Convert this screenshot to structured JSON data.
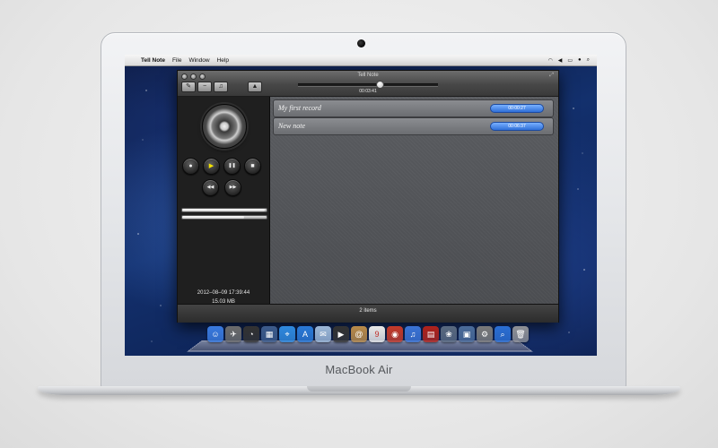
{
  "laptop": {
    "brand": "MacBook Air"
  },
  "menubar": {
    "apple": "",
    "items": [
      "Tell Note",
      "File",
      "Window",
      "Help"
    ]
  },
  "window": {
    "title": "Tell Note",
    "toolbar": {
      "btn_edit": "✎",
      "btn_remove": "−",
      "btn_music": "♫",
      "btn_eject": "▲"
    },
    "playback_time": "00:03:41",
    "playback_progress": 0.58
  },
  "player": {
    "controls": {
      "record": "●",
      "play": "▶",
      "pause": "❚❚",
      "stop": "■",
      "rewind": "◀◀",
      "forward": "▶▶"
    },
    "volume_level": 0.98,
    "position_level": 0.73,
    "date": "2012–08–09 17:39:44",
    "size": "15.03 MB"
  },
  "notes": [
    {
      "name": "My first record",
      "duration": "00:00:27"
    },
    {
      "name": "New note",
      "duration": "00:06:37"
    }
  ],
  "status": {
    "count_text": "2 items"
  },
  "dock": [
    {
      "icon": "finder-icon",
      "glyph": "☺",
      "color": "#3a7be0"
    },
    {
      "icon": "launchpad-icon",
      "glyph": "✈",
      "color": "#6c6c6c"
    },
    {
      "icon": "dashboard-icon",
      "glyph": "◔",
      "color": "#333333"
    },
    {
      "icon": "mission-control-icon",
      "glyph": "▦",
      "color": "#3d5c8c"
    },
    {
      "icon": "safari-icon",
      "glyph": "⌖",
      "color": "#2f8ae0"
    },
    {
      "icon": "app-store-icon",
      "glyph": "A",
      "color": "#2a7ad8"
    },
    {
      "icon": "mail-icon",
      "glyph": "✉",
      "color": "#9bb7d8"
    },
    {
      "icon": "facetime-icon",
      "glyph": "▶",
      "color": "#333333"
    },
    {
      "icon": "contacts-icon",
      "glyph": "@",
      "color": "#b88a4a"
    },
    {
      "icon": "calendar-icon",
      "glyph": "9",
      "color": "#e9e9e9"
    },
    {
      "icon": "photo-booth-icon",
      "glyph": "◉",
      "color": "#c43a2a"
    },
    {
      "icon": "itunes-icon",
      "glyph": "♫",
      "color": "#3b74d6"
    },
    {
      "icon": "tell-note-icon",
      "glyph": "▤",
      "color": "#b0231c"
    },
    {
      "icon": "iphoto-icon",
      "glyph": "❀",
      "color": "#5a6a80"
    },
    {
      "icon": "preview-icon",
      "glyph": "▣",
      "color": "#4b6c9a"
    },
    {
      "icon": "system-preferences-icon",
      "glyph": "⚙",
      "color": "#7a7a7a"
    },
    {
      "icon": "spotlight-icon",
      "glyph": "⌕",
      "color": "#2b6fd4"
    },
    {
      "icon": "trash-icon",
      "glyph": "🗑",
      "color": "#8e9096"
    }
  ]
}
